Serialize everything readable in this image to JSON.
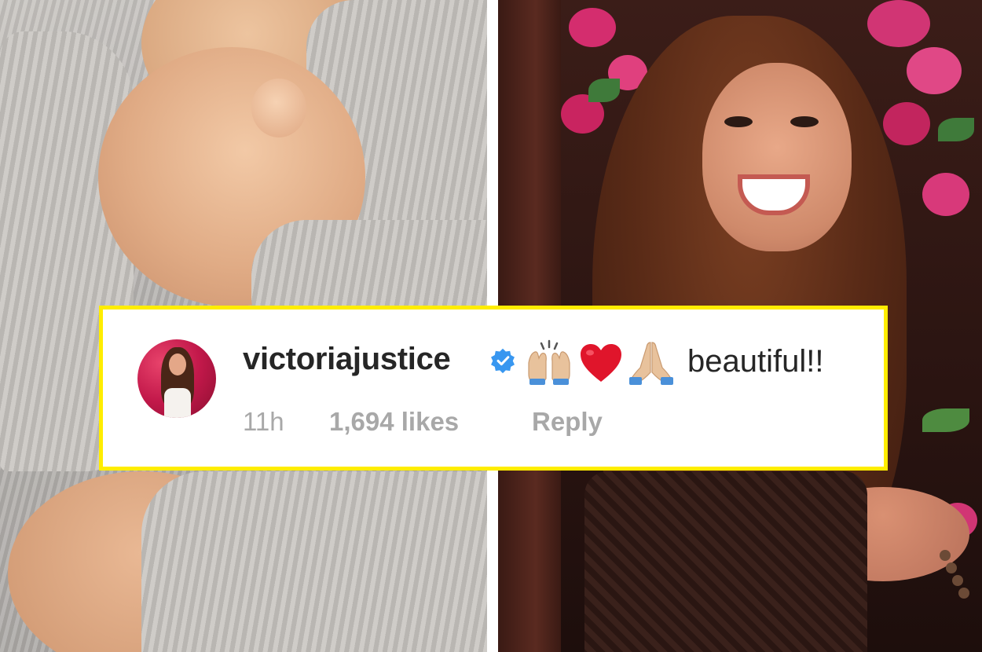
{
  "comment": {
    "username": "victoriajustice",
    "text": "beautiful!!",
    "time": "11h",
    "likes": "1,694 likes",
    "reply_label": "Reply",
    "verified": true,
    "emojis": [
      "raising-hands-emoji",
      "red-heart-emoji",
      "folded-hands-emoji"
    ]
  },
  "colors": {
    "highlight_border": "#ffed00",
    "verified_badge": "#3897f0",
    "username_text": "#262626",
    "meta_text": "#a8a8a8"
  }
}
